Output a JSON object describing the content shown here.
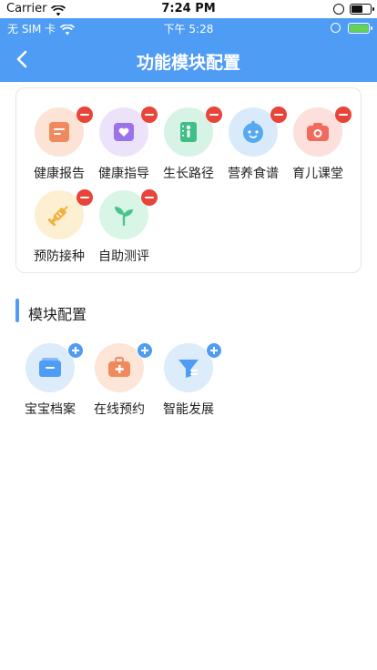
{
  "sim_status": {
    "carrier": "Carrier",
    "time": "7:24 PM"
  },
  "app_status": {
    "carrier": "无 SIM 卡",
    "time": "下午 5:28"
  },
  "header": {
    "title": "功能模块配置",
    "back_icon": "chevron-left-icon"
  },
  "active_modules": [
    {
      "label": "健康报告",
      "icon": "report-icon",
      "bg": "#fde3d6",
      "color": "#f08a5d"
    },
    {
      "label": "健康指导",
      "icon": "guide-heart-icon",
      "bg": "#ece3fb",
      "color": "#9b72e8"
    },
    {
      "label": "生长路径",
      "icon": "growth-chart-icon",
      "bg": "#d7f3e6",
      "color": "#3fbf86"
    },
    {
      "label": "营养食谱",
      "icon": "baby-face-icon",
      "bg": "#d9ebfb",
      "color": "#56a8f0"
    },
    {
      "label": "育儿课堂",
      "icon": "camera-icon",
      "bg": "#fde0dc",
      "color": "#f26a5b"
    },
    {
      "label": "预防接种",
      "icon": "vaccine-icon",
      "bg": "#fdf0d2",
      "color": "#f2b13c"
    },
    {
      "label": "自助测评",
      "icon": "sprout-icon",
      "bg": "#d9f5e6",
      "color": "#49c58c"
    }
  ],
  "section": {
    "title": "模块配置"
  },
  "available_modules": [
    {
      "label": "宝宝档案",
      "icon": "folder-icon",
      "bg": "#dcecfb",
      "color": "#4f9cf5"
    },
    {
      "label": "在线预约",
      "icon": "medical-kit-icon",
      "bg": "#fde5d8",
      "color": "#f08a5d"
    },
    {
      "label": "智能发展",
      "icon": "funnel-icon",
      "bg": "#dcecfb",
      "color": "#4f9cf5"
    }
  ]
}
